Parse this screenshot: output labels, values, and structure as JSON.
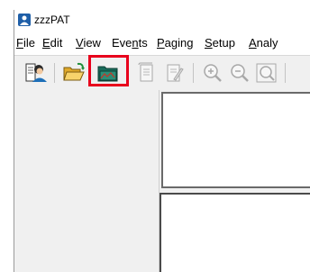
{
  "window": {
    "title": "zzzPAT"
  },
  "menubar": {
    "items": [
      {
        "pre": "",
        "u": "F",
        "post": "ile"
      },
      {
        "pre": "",
        "u": "E",
        "post": "dit"
      },
      {
        "pre": "",
        "u": "V",
        "post": "iew"
      },
      {
        "pre": "Eve",
        "u": "n",
        "post": "ts"
      },
      {
        "pre": "",
        "u": "P",
        "post": "aging"
      },
      {
        "pre": "",
        "u": "S",
        "post": "etup"
      },
      {
        "pre": "",
        "u": "A",
        "post": "naly"
      }
    ]
  },
  "toolbar": {
    "buttons": [
      {
        "icon": "patient-icon",
        "enabled": true
      },
      {
        "icon": "open-folder-icon",
        "enabled": true
      },
      {
        "icon": "open-study-folder-icon",
        "enabled": true,
        "highlighted": true
      },
      {
        "icon": "report-icon",
        "enabled": false
      },
      {
        "icon": "report-edit-icon",
        "enabled": false
      },
      {
        "icon": "zoom-in-icon",
        "enabled": false
      },
      {
        "icon": "zoom-out-icon",
        "enabled": false
      },
      {
        "icon": "zoom-fit-icon",
        "enabled": false
      }
    ]
  },
  "colors": {
    "highlight": "#e8001c",
    "folder": "#f2c94c",
    "folder_dark": "#1a6b5a"
  }
}
